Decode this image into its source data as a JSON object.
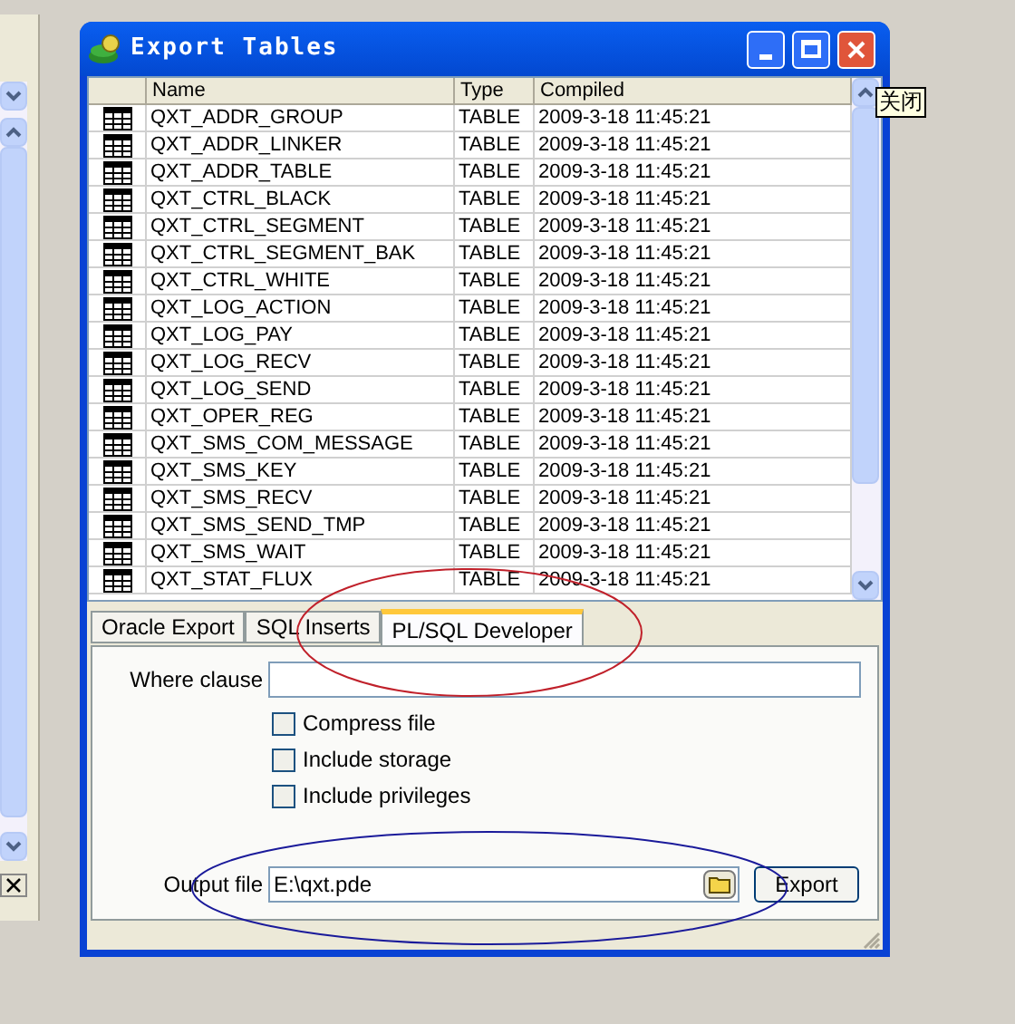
{
  "window": {
    "title": "Export Tables",
    "tooltip": "关闭"
  },
  "table": {
    "columns": [
      "Name",
      "Type",
      "Compiled"
    ],
    "rows": [
      [
        "QXT_ADDR_GROUP",
        "TABLE",
        "2009-3-18 11:45:21"
      ],
      [
        "QXT_ADDR_LINKER",
        "TABLE",
        "2009-3-18 11:45:21"
      ],
      [
        "QXT_ADDR_TABLE",
        "TABLE",
        "2009-3-18 11:45:21"
      ],
      [
        "QXT_CTRL_BLACK",
        "TABLE",
        "2009-3-18 11:45:21"
      ],
      [
        "QXT_CTRL_SEGMENT",
        "TABLE",
        "2009-3-18 11:45:21"
      ],
      [
        "QXT_CTRL_SEGMENT_BAK",
        "TABLE",
        "2009-3-18 11:45:21"
      ],
      [
        "QXT_CTRL_WHITE",
        "TABLE",
        "2009-3-18 11:45:21"
      ],
      [
        "QXT_LOG_ACTION",
        "TABLE",
        "2009-3-18 11:45:21"
      ],
      [
        "QXT_LOG_PAY",
        "TABLE",
        "2009-3-18 11:45:21"
      ],
      [
        "QXT_LOG_RECV",
        "TABLE",
        "2009-3-18 11:45:21"
      ],
      [
        "QXT_LOG_SEND",
        "TABLE",
        "2009-3-18 11:45:21"
      ],
      [
        "QXT_OPER_REG",
        "TABLE",
        "2009-3-18 11:45:21"
      ],
      [
        "QXT_SMS_COM_MESSAGE",
        "TABLE",
        "2009-3-18 11:45:21"
      ],
      [
        "QXT_SMS_KEY",
        "TABLE",
        "2009-3-18 11:45:21"
      ],
      [
        "QXT_SMS_RECV",
        "TABLE",
        "2009-3-18 11:45:21"
      ],
      [
        "QXT_SMS_SEND_TMP",
        "TABLE",
        "2009-3-18 11:45:21"
      ],
      [
        "QXT_SMS_WAIT",
        "TABLE",
        "2009-3-18 11:45:21"
      ],
      [
        "QXT_STAT_FLUX",
        "TABLE",
        "2009-3-18 11:45:21"
      ]
    ]
  },
  "tabs": [
    {
      "label": "Oracle Export",
      "selected": false
    },
    {
      "label": "SQL Inserts",
      "selected": false
    },
    {
      "label": "PL/SQL Developer",
      "selected": true
    }
  ],
  "where_clause": {
    "label": "Where clause"
  },
  "options": [
    {
      "label": "Compress file",
      "checked": false
    },
    {
      "label": "Include storage",
      "checked": false
    },
    {
      "label": "Include privileges",
      "checked": false
    }
  ],
  "output_file": {
    "label": "Output file",
    "value": "E:\\qxt.pde"
  },
  "export_button": "Export"
}
